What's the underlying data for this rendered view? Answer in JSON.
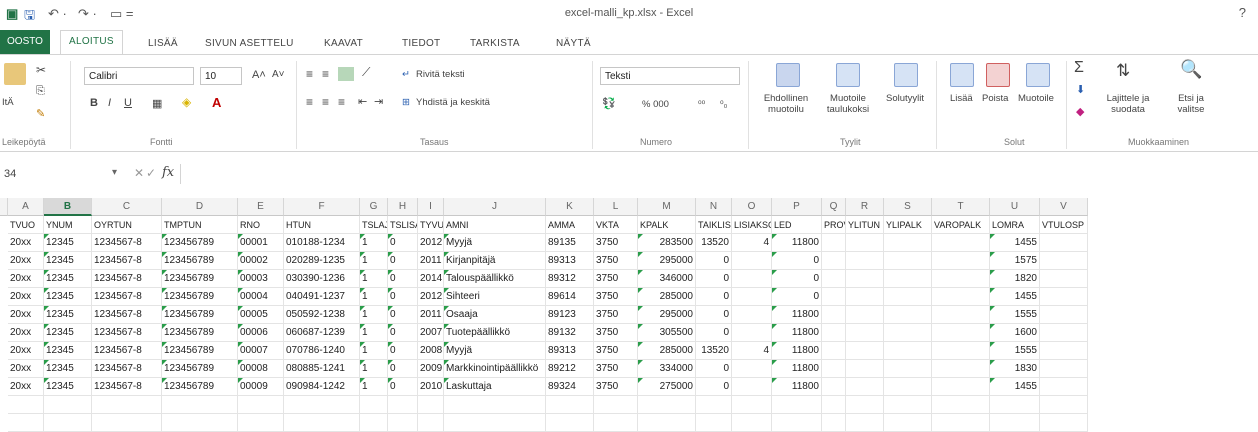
{
  "window": {
    "title": "excel-malli_kp.xlsx - Excel",
    "help_label": "?"
  },
  "quick_access": {
    "undo_label": "↶ ·",
    "redo_label": "↷ ·",
    "customize_label": "▭ ="
  },
  "tabs": [
    "OOSTO",
    "ALOITUS",
    "LISÄÄ",
    "SIVUN ASETTELU",
    "KAAVAT",
    "TIEDOT",
    "TARKISTA",
    "NÄYTÄ"
  ],
  "ribbon": {
    "clipboard": {
      "paste_label": "ItÄ",
      "group": "Leikepöytä"
    },
    "font": {
      "name": "Calibri",
      "size": "10",
      "group": "Fontti"
    },
    "alignment": {
      "wrap_label": "Rivitä teksti",
      "merge_label": "Yhdistä ja keskitä",
      "group": "Tasaus"
    },
    "number": {
      "format": "Teksti",
      "percent_label": "% 000",
      "group": "Numero"
    },
    "styles": {
      "conditional_label": "Ehdollinen\nmuotoilu",
      "format_table_label": "Muotoile\ntaulukoksi",
      "cell_styles_label": "Solutyylit",
      "group": "Tyylit"
    },
    "cells": {
      "insert_label": "Lisää",
      "delete_label": "Poista",
      "format_label": "Muotoile",
      "group": "Solut"
    },
    "editing": {
      "sort_label": "Lajittele ja\nsuodata",
      "find_label": "Etsi ja\nvalitse",
      "group": "Muokkaaminen"
    }
  },
  "formula_bar": {
    "name_box": "34",
    "fx_label": "fx",
    "cancel_label": "✕",
    "confirm_label": "✓",
    "value": ""
  },
  "columns": [
    "A",
    "B",
    "C",
    "D",
    "E",
    "F",
    "G",
    "H",
    "I",
    "J",
    "K",
    "L",
    "M",
    "N",
    "O",
    "P",
    "Q",
    "R",
    "S",
    "T",
    "U",
    "V"
  ],
  "selected_column": "B",
  "header_row": [
    "TVUO",
    "YNUM",
    "OYRTUN",
    "TMPTUN",
    "RNO",
    "HTUN",
    "TSLAJ",
    "TSLISA",
    "TYVU",
    "AMNI",
    "AMMA",
    "VKTA",
    "KPALK",
    "TAIKLIS",
    "LISIAKSO",
    "LED",
    "PROV",
    "YLITUN",
    "YLIPALK",
    "VAROPALK",
    "LOMRA",
    "VTULOSP"
  ],
  "rows": [
    [
      "20xx",
      "12345",
      "1234567-8",
      "123456789",
      "00001",
      "010188-1234",
      "1",
      "0",
      "2012",
      "Myyjä",
      "89135",
      "3750",
      "283500",
      "13520",
      "4",
      "11800",
      "",
      "",
      "",
      "",
      "1455",
      ""
    ],
    [
      "20xx",
      "12345",
      "1234567-8",
      "123456789",
      "00002",
      "020289-1235",
      "1",
      "0",
      "2011",
      "Kirjanpitäjä",
      "89313",
      "3750",
      "295000",
      "0",
      "",
      "0",
      "",
      "",
      "",
      "",
      "1575",
      ""
    ],
    [
      "20xx",
      "12345",
      "1234567-8",
      "123456789",
      "00003",
      "030390-1236",
      "1",
      "0",
      "2014",
      "Talouspäällikkö",
      "89312",
      "3750",
      "346000",
      "0",
      "",
      "0",
      "",
      "",
      "",
      "",
      "1820",
      ""
    ],
    [
      "20xx",
      "12345",
      "1234567-8",
      "123456789",
      "00004",
      "040491-1237",
      "1",
      "0",
      "2012",
      "Sihteeri",
      "89614",
      "3750",
      "285000",
      "0",
      "",
      "0",
      "",
      "",
      "",
      "",
      "1455",
      ""
    ],
    [
      "20xx",
      "12345",
      "1234567-8",
      "123456789",
      "00005",
      "050592-1238",
      "1",
      "0",
      "2011",
      "Osaaja",
      "89123",
      "3750",
      "295000",
      "0",
      "",
      "11800",
      "",
      "",
      "",
      "",
      "1555",
      ""
    ],
    [
      "20xx",
      "12345",
      "1234567-8",
      "123456789",
      "00006",
      "060687-1239",
      "1",
      "0",
      "2007",
      "Tuotepäällikkö",
      "89132",
      "3750",
      "305500",
      "0",
      "",
      "11800",
      "",
      "",
      "",
      "",
      "1600",
      ""
    ],
    [
      "20xx",
      "12345",
      "1234567-8",
      "123456789",
      "00007",
      "070786-1240",
      "1",
      "0",
      "2008",
      "Myyjä",
      "89313",
      "3750",
      "285000",
      "13520",
      "4",
      "11800",
      "",
      "",
      "",
      "",
      "1555",
      ""
    ],
    [
      "20xx",
      "12345",
      "1234567-8",
      "123456789",
      "00008",
      "080885-1241",
      "1",
      "0",
      "2009",
      "Markkinointipäällikkö",
      "89212",
      "3750",
      "334000",
      "0",
      "",
      "11800",
      "",
      "",
      "",
      "",
      "1830",
      ""
    ],
    [
      "20xx",
      "12345",
      "1234567-8",
      "123456789",
      "00009",
      "090984-1242",
      "1",
      "0",
      "2010",
      "Laskuttaja",
      "89324",
      "3750",
      "275000",
      "0",
      "",
      "11800",
      "",
      "",
      "",
      "",
      "1455",
      ""
    ]
  ],
  "text_marker_columns": [
    1,
    3,
    4,
    6,
    7,
    9,
    12,
    15,
    20
  ],
  "right_aligned_columns": [
    8,
    12,
    13,
    14,
    15,
    20
  ],
  "colors": {
    "accent": "#217346",
    "text_marker": "#2a9d4a"
  }
}
